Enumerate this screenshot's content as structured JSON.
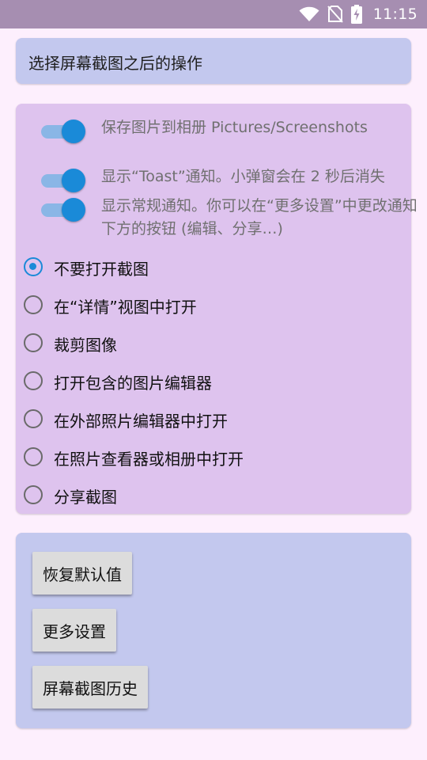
{
  "status_bar": {
    "time": "11:15",
    "icons": [
      "wifi-icon",
      "no-sim-icon",
      "battery-charging-icon"
    ],
    "background": "#a68eb1"
  },
  "header": {
    "title": "选择屏幕截图之后的操作"
  },
  "switches": [
    {
      "label": "保存图片到相册 Pictures/Screenshots",
      "on": true
    },
    {
      "label": "显示“Toast”通知。小弹窗会在 2 秒后消失",
      "on": true
    },
    {
      "label": "显示常规通知。你可以在“更多设置”中更改通知下方的按钮 (编辑、分享…)",
      "on": true
    }
  ],
  "radio_options": [
    {
      "label": "不要打开截图",
      "checked": true
    },
    {
      "label": "在“详情”视图中打开",
      "checked": false
    },
    {
      "label": "裁剪图像",
      "checked": false
    },
    {
      "label": "打开包含的图片编辑器",
      "checked": false
    },
    {
      "label": "在外部照片编辑器中打开",
      "checked": false
    },
    {
      "label": "在照片查看器或相册中打开",
      "checked": false
    },
    {
      "label": "分享截图",
      "checked": false
    }
  ],
  "buttons": {
    "restore_defaults": "恢复默认值",
    "more_settings": "更多设置",
    "screenshot_history": "屏幕截图历史"
  },
  "colors": {
    "accent": "#1a8ad8",
    "page_background": "#fdeffd",
    "title_card": "#c3c8ee",
    "options_card": "#dec3ee",
    "buttons_card": "#c3c8ee"
  }
}
